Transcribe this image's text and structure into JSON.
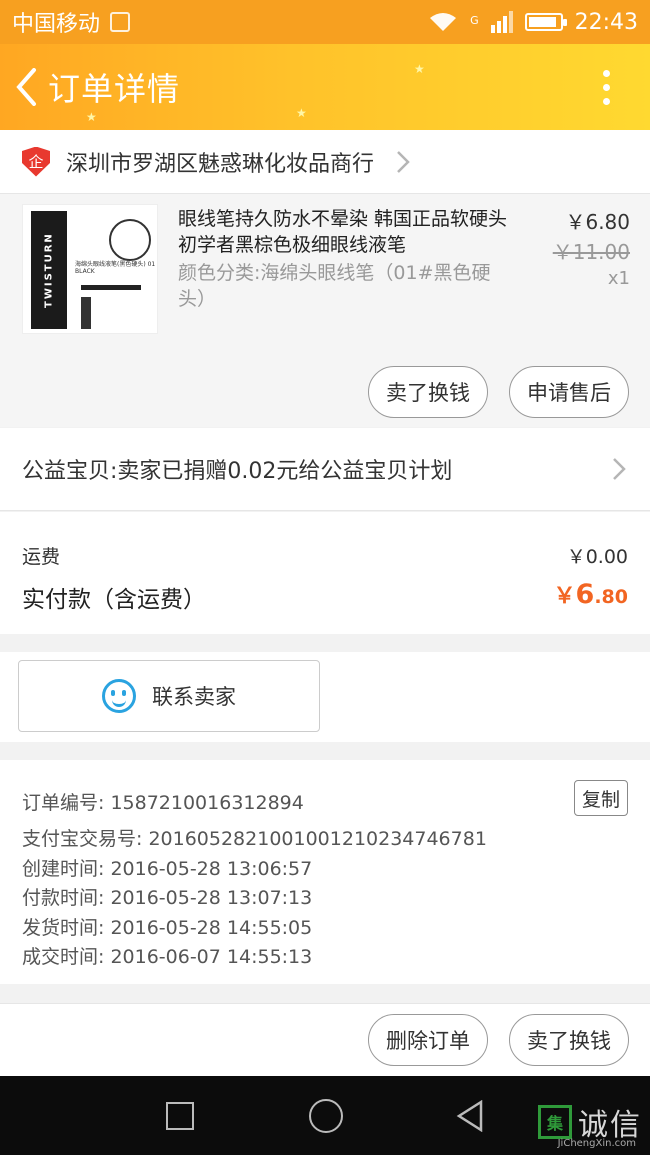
{
  "status_bar": {
    "carrier": "中国移动",
    "time": "22:43",
    "network": "G"
  },
  "header": {
    "title": "订单详情",
    "back_icon": "chevron-left-icon",
    "more_icon": "more-vert-icon"
  },
  "shop": {
    "name": "深圳市罗湖区魅惑琳化妆品商行",
    "badge": "企"
  },
  "item": {
    "name": "眼线笔持久防水不晕染 韩国正品软硬头初学者黑棕色极细眼线液笔",
    "attributes": "颜色分类:海绵头眼线笔（01#黑色硬头）",
    "price": "￥6.80",
    "original_price": "￥11.00",
    "quantity": "x1",
    "thumb_brand": "TWISTURN",
    "thumb_caption": "海绵头眼线液笔(黑色硬头) 01 BLACK",
    "actions": [
      "卖了换钱",
      "申请售后"
    ]
  },
  "charity": {
    "text": "公益宝贝:卖家已捐赠0.02元给公益宝贝计划"
  },
  "cost": {
    "shipping_label": "运费",
    "shipping_value": "￥0.00",
    "total_label": "实付款（含运费）",
    "total_currency": "￥",
    "total_int": "6",
    "total_dec": ".80"
  },
  "contact": {
    "label": "联系卖家"
  },
  "order_info": {
    "order_no": "订单编号: 1587210016312894",
    "copy_label": "复制",
    "alipay_no": "支付宝交易号: 2016052821001001210234746781",
    "created": "创建时间: 2016-05-28 13:06:57",
    "paid": "付款时间: 2016-05-28 13:07:13",
    "shipped": "发货时间: 2016-05-28 14:55:05",
    "completed": "成交时间: 2016-06-07 14:55:13"
  },
  "bottom_actions": [
    "删除订单",
    "卖了换钱"
  ],
  "watermark": {
    "text": "诚信",
    "sub": "JiChengXin.com",
    "glyph": "集"
  },
  "colors": {
    "accent": "#f7a020",
    "price_orange": "#f26522",
    "wangwang_blue": "#2aa3e0"
  }
}
